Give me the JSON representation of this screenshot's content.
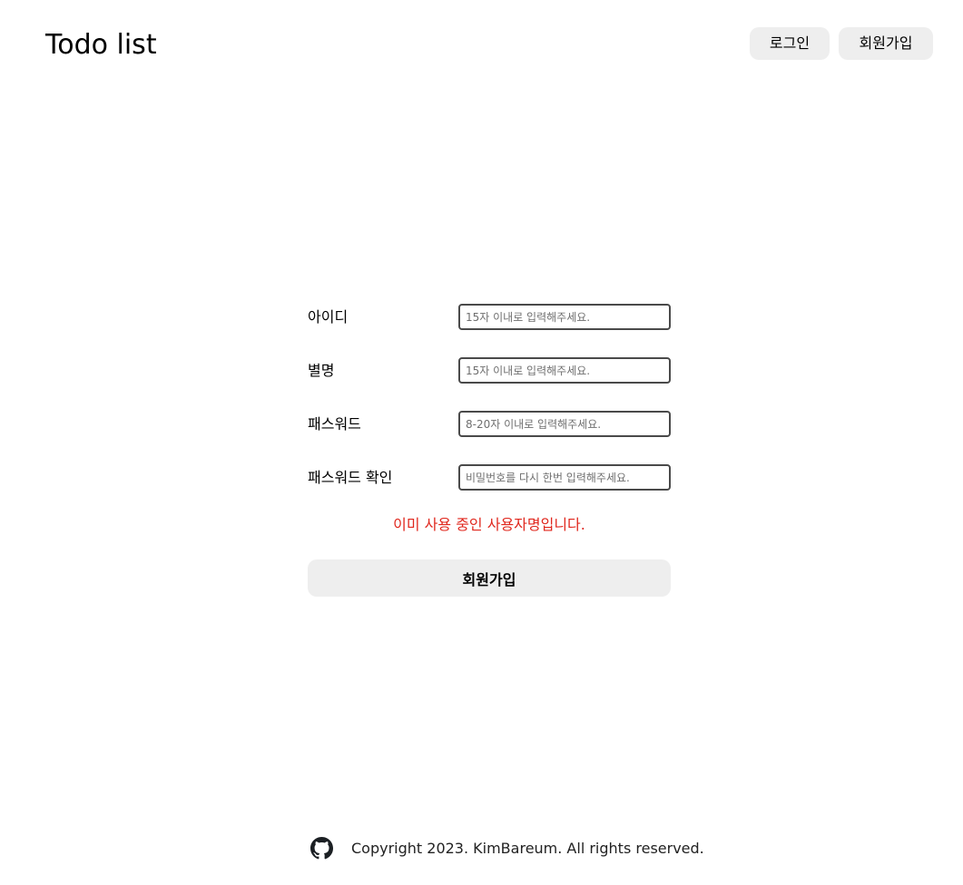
{
  "header": {
    "logo": "Todo list",
    "login_label": "로그인",
    "signup_label": "회원가입"
  },
  "form": {
    "fields": [
      {
        "label": "아이디",
        "placeholder": "15자 이내로 입력해주세요.",
        "value": ""
      },
      {
        "label": "별명",
        "placeholder": "15자 이내로 입력해주세요.",
        "value": ""
      },
      {
        "label": "패스워드",
        "placeholder": "8-20자 이내로 입력해주세요.",
        "value": ""
      },
      {
        "label": "패스워드 확인",
        "placeholder": "비밀번호를 다시 한번 입력해주세요.",
        "value": ""
      }
    ],
    "error": "이미 사용 중인 사용자명입니다.",
    "submit_label": "회원가입"
  },
  "footer": {
    "icon": "github-icon",
    "copyright": "Copyright 2023. KimBareum. All rights reserved."
  },
  "colors": {
    "button_bg": "#eeeeee",
    "error": "#e0271d",
    "input_border": "#4a4a4a"
  }
}
